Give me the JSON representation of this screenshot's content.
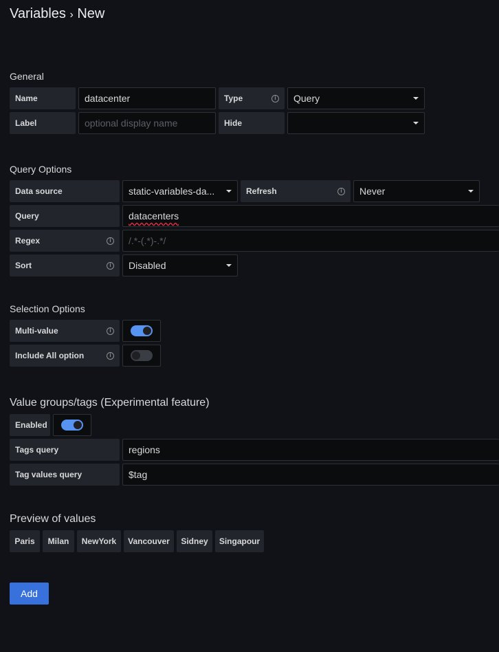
{
  "breadcrumb": {
    "parent": "Variables",
    "separator": "›",
    "current": "New"
  },
  "general": {
    "heading": "General",
    "name_label": "Name",
    "name_value": "datacenter",
    "type_label": "Type",
    "type_value": "Query",
    "label_label": "Label",
    "label_placeholder": "optional display name",
    "hide_label": "Hide",
    "hide_value": ""
  },
  "query_options": {
    "heading": "Query Options",
    "datasource_label": "Data source",
    "datasource_value": "static-variables-da...",
    "refresh_label": "Refresh",
    "refresh_value": "Never",
    "query_label": "Query",
    "query_value": "datacenters",
    "regex_label": "Regex",
    "regex_placeholder": "/.*-(.*)-.*/",
    "sort_label": "Sort",
    "sort_value": "Disabled"
  },
  "selection_options": {
    "heading": "Selection Options",
    "multi_label": "Multi-value",
    "multi_on": true,
    "include_all_label": "Include All option",
    "include_all_on": false
  },
  "tags": {
    "heading": "Value groups/tags (Experimental feature)",
    "enabled_label": "Enabled",
    "enabled_on": true,
    "tags_query_label": "Tags query",
    "tags_query_value": "regions",
    "tag_values_label": "Tag values query",
    "tag_values_value": "$tag"
  },
  "preview": {
    "heading": "Preview of values",
    "values": [
      "Paris",
      "Milan",
      "NewYork",
      "Vancouver",
      "Sidney",
      "Singapour"
    ]
  },
  "actions": {
    "add_label": "Add"
  },
  "colors": {
    "background": "#111217",
    "accent": "#5794f2",
    "primary_button": "#3871dc"
  },
  "icons": {
    "info": "info-circle-icon",
    "caret": "caret-down-icon"
  }
}
